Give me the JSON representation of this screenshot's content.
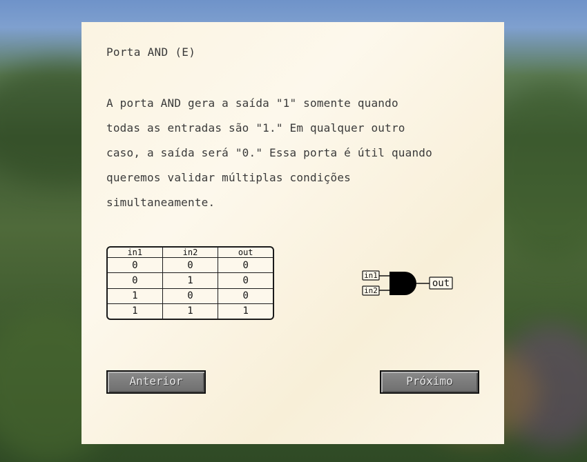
{
  "panel": {
    "title": "Porta AND (E)",
    "description_lines": [
      "A porta AND gera a saída \"1\" somente quando",
      "todas as entradas são \"1.\" Em qualquer outro",
      "caso, a saída será \"0.\" Essa porta é útil quando",
      "queremos validar múltiplas condições",
      "simultaneamente."
    ]
  },
  "truth_table": {
    "headers": [
      "in1",
      "in2",
      "out"
    ],
    "rows": [
      [
        "0",
        "0",
        "0"
      ],
      [
        "0",
        "1",
        "0"
      ],
      [
        "1",
        "0",
        "0"
      ],
      [
        "1",
        "1",
        "1"
      ]
    ]
  },
  "gate_diagram": {
    "input1_label": "in1",
    "input2_label": "in2",
    "output_label": "out"
  },
  "buttons": {
    "previous_label": "Anterior",
    "next_label": "Próximo"
  }
}
